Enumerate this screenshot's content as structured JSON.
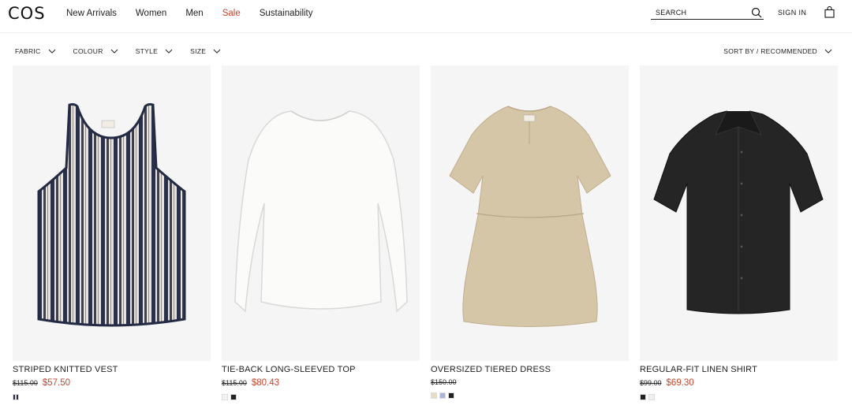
{
  "header": {
    "logo": "COS",
    "nav": [
      {
        "label": "New Arrivals",
        "key": "new-arrivals"
      },
      {
        "label": "Women",
        "key": "women"
      },
      {
        "label": "Men",
        "key": "men"
      },
      {
        "label": "Sale",
        "key": "sale"
      },
      {
        "label": "Sustainability",
        "key": "sustainability"
      }
    ],
    "search_label": "SEARCH",
    "signin": "SIGN IN"
  },
  "filters": [
    "FABRIC",
    "COLOUR",
    "STYLE",
    "SIZE"
  ],
  "sort": "SORT BY / RECOMMENDED",
  "colors": {
    "sale": "#c8452c",
    "text": "#222222",
    "image_bg": "#f5f5f5"
  },
  "products": [
    {
      "name": "STRIPED KNITTED VEST",
      "old_price": "$115.00",
      "new_price": "$57.50",
      "swatches": [
        "#5a5f70"
      ]
    },
    {
      "name": "TIE-BACK LONG-SLEEVED TOP",
      "old_price": "$115.00",
      "new_price": "$80.43",
      "swatches": [
        "#f2f2f0",
        "#222222"
      ]
    },
    {
      "name": "OVERSIZED TIERED DRESS",
      "old_price": "$150.00",
      "new_price": "",
      "swatches": [
        "#e9dcc4",
        "#aab4d6",
        "#222222"
      ]
    },
    {
      "name": "REGULAR-FIT LINEN SHIRT",
      "old_price": "$99.00",
      "new_price": "$69.30",
      "swatches": [
        "#222222",
        "#efefef"
      ]
    }
  ]
}
